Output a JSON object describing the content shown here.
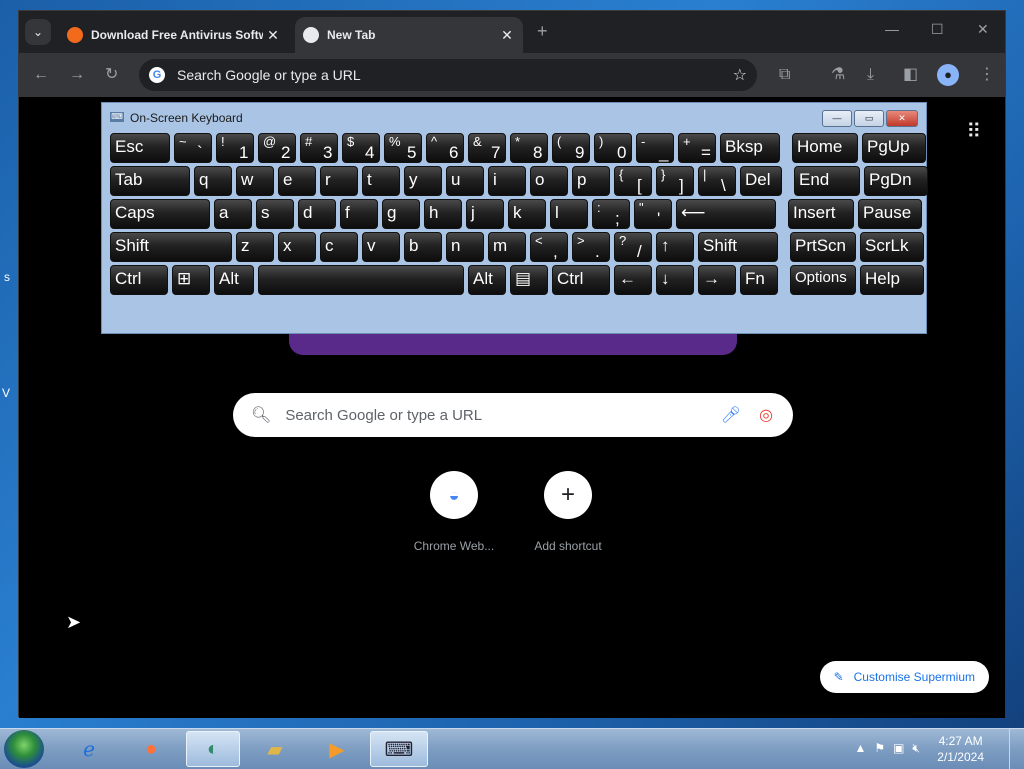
{
  "browser": {
    "tabs": [
      {
        "title": "Download Free Antivirus Softw",
        "favicon": "avast-icon",
        "active": false
      },
      {
        "title": "New Tab",
        "favicon": "newtab-icon",
        "active": true
      }
    ],
    "omnibox": {
      "placeholder": "Search Google or type a URL"
    },
    "ntp": {
      "search_placeholder": "Search Google or type a URL",
      "shortcuts": [
        {
          "label": "Chrome Web...",
          "icon": "chrome-web-store-icon"
        },
        {
          "label": "Add shortcut",
          "icon": "plus-icon"
        }
      ],
      "customise_label": "Customise Supermium"
    }
  },
  "osk": {
    "title": "On-Screen Keyboard",
    "rows": [
      [
        {
          "label": "Esc"
        },
        {
          "top": "~",
          "bottom": "`"
        },
        {
          "top": "!",
          "bottom": "1"
        },
        {
          "top": "@",
          "bottom": "2"
        },
        {
          "top": "#",
          "bottom": "3"
        },
        {
          "top": "$",
          "bottom": "4"
        },
        {
          "top": "%",
          "bottom": "5"
        },
        {
          "top": "^",
          "bottom": "6"
        },
        {
          "top": "&",
          "bottom": "7"
        },
        {
          "top": "*",
          "bottom": "8"
        },
        {
          "top": "(",
          "bottom": "9"
        },
        {
          "top": ")",
          "bottom": "0"
        },
        {
          "top": "-",
          "bottom": "_"
        },
        {
          "top": "+",
          "bottom": "="
        },
        {
          "label": "Bksp"
        },
        {
          "label": "Home"
        },
        {
          "label": "PgUp"
        }
      ],
      [
        {
          "label": "Tab"
        },
        {
          "label": "q"
        },
        {
          "label": "w"
        },
        {
          "label": "e"
        },
        {
          "label": "r"
        },
        {
          "label": "t"
        },
        {
          "label": "y"
        },
        {
          "label": "u"
        },
        {
          "label": "i"
        },
        {
          "label": "o"
        },
        {
          "label": "p"
        },
        {
          "top": "{",
          "bottom": "["
        },
        {
          "top": "}",
          "bottom": "]"
        },
        {
          "top": "|",
          "bottom": "\\"
        },
        {
          "label": "Del"
        },
        {
          "label": "End"
        },
        {
          "label": "PgDn"
        }
      ],
      [
        {
          "label": "Caps"
        },
        {
          "label": "a"
        },
        {
          "label": "s"
        },
        {
          "label": "d"
        },
        {
          "label": "f"
        },
        {
          "label": "g"
        },
        {
          "label": "h"
        },
        {
          "label": "j"
        },
        {
          "label": "k"
        },
        {
          "label": "l"
        },
        {
          "top": ":",
          "bottom": ";"
        },
        {
          "top": "\"",
          "bottom": "'"
        },
        {
          "label": "⟵"
        },
        {
          "label": "Insert"
        },
        {
          "label": "Pause"
        }
      ],
      [
        {
          "label": "Shift"
        },
        {
          "label": "z"
        },
        {
          "label": "x"
        },
        {
          "label": "c"
        },
        {
          "label": "v"
        },
        {
          "label": "b"
        },
        {
          "label": "n"
        },
        {
          "label": "m"
        },
        {
          "top": "<",
          "bottom": ","
        },
        {
          "top": ">",
          "bottom": "."
        },
        {
          "top": "?",
          "bottom": "/"
        },
        {
          "label": "↑"
        },
        {
          "label": "Shift"
        },
        {
          "label": "PrtScn"
        },
        {
          "label": "ScrLk"
        }
      ],
      [
        {
          "label": "Ctrl"
        },
        {
          "label": "⊞"
        },
        {
          "label": "Alt"
        },
        {
          "label": ""
        },
        {
          "label": "Alt"
        },
        {
          "label": "▤"
        },
        {
          "label": "Ctrl"
        },
        {
          "label": "←"
        },
        {
          "label": "↓"
        },
        {
          "label": "→"
        },
        {
          "label": "Fn"
        },
        {
          "label": "Options"
        },
        {
          "label": "Help"
        }
      ]
    ]
  },
  "taskbar": {
    "items": [
      "start-button",
      "internet-explorer-icon",
      "firefox-icon",
      "supermium-icon",
      "file-explorer-icon",
      "media-player-icon",
      "on-screen-keyboard-icon"
    ],
    "time": "4:27 AM",
    "date": "2/1/2024"
  }
}
